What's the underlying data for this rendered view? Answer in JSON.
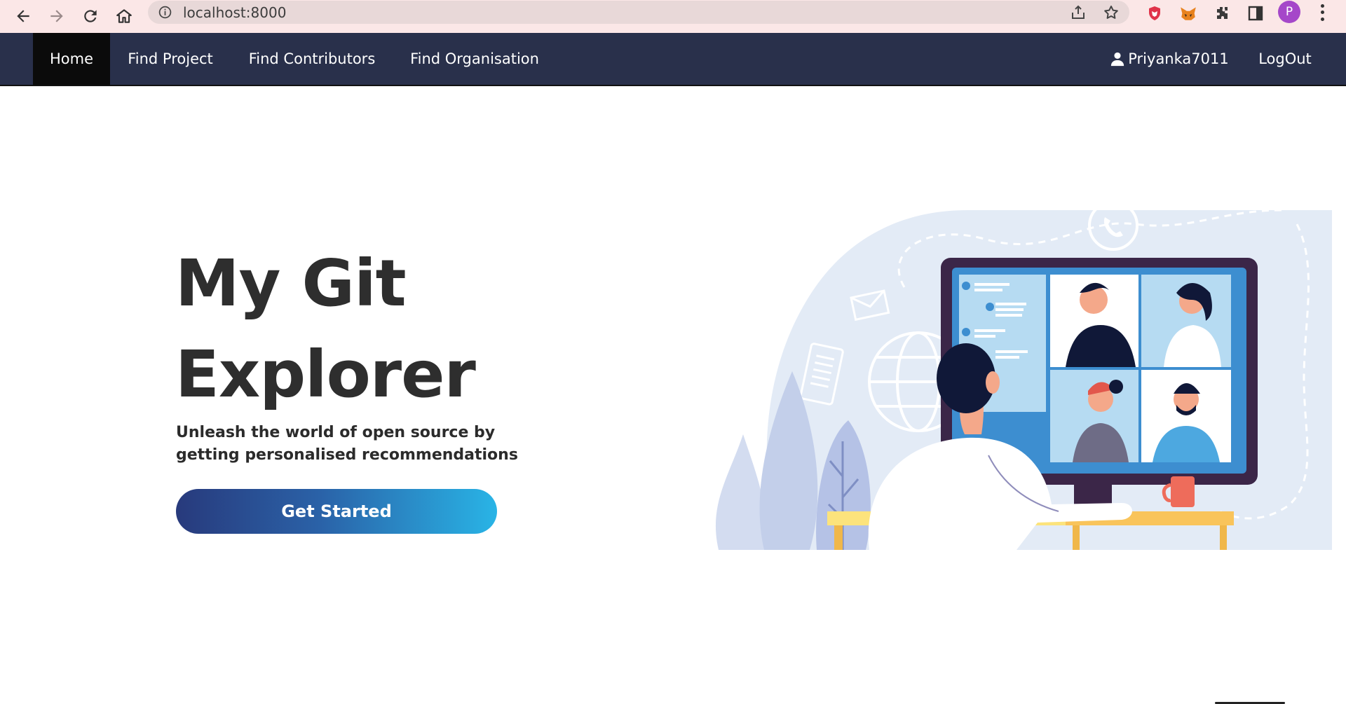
{
  "browser": {
    "url": "localhost:8000",
    "profile_initial": "P",
    "icons": [
      "back-icon",
      "forward-icon",
      "reload-icon",
      "home-icon",
      "info-icon",
      "share-icon",
      "star-icon",
      "shield-extension-icon",
      "fox-extension-icon",
      "puzzle-icon",
      "sidepanel-icon",
      "kebab-menu-icon"
    ]
  },
  "navbar": {
    "items": [
      {
        "label": "Home",
        "active": true
      },
      {
        "label": "Find Project"
      },
      {
        "label": "Find Contributors"
      },
      {
        "label": "Find Organisation"
      }
    ],
    "user": {
      "name": "Priyanka7011",
      "icon": "user-icon"
    },
    "logout_label": "LogOut",
    "colors": {
      "background": "#29304b",
      "active": "#0b0b0b"
    }
  },
  "hero": {
    "title_line1": "My Git",
    "title_line2": "Explorer",
    "subtitle_line1": "Unleash the world of open source by",
    "subtitle_line2": "getting personalised recommendations",
    "cta_label": "Get Started",
    "cta_gradient": [
      "#283a7c",
      "#29b4e6"
    ]
  }
}
